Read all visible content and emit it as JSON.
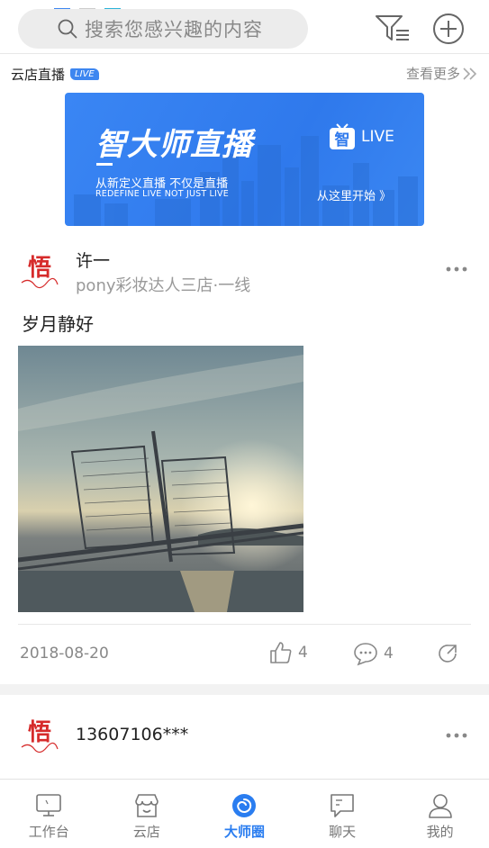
{
  "search": {
    "placeholder": "搜索您感兴趣的内容"
  },
  "live_section": {
    "title": "云店直播",
    "badge": "LIVE",
    "see_more": "查看更多"
  },
  "banner": {
    "title": "智大师直播",
    "live_label": "LIVE",
    "tv_glyph": "智",
    "subtitle_cn": "从新定义直播  不仅是直播",
    "subtitle_en": "REDEFINE LIVE  NOT JUST LIVE",
    "start_label": "从这里开始 》"
  },
  "posts": [
    {
      "name": "许一",
      "shop": "pony彩妆达人三店·一线",
      "text": "岁月静好",
      "date": "2018-08-20",
      "likes": "4",
      "comments": "4"
    },
    {
      "name": "13607106***"
    }
  ],
  "tabs": [
    {
      "label": "工作台",
      "icon": "monitor-icon",
      "active": false
    },
    {
      "label": "云店",
      "icon": "shop-icon",
      "active": false
    },
    {
      "label": "大师圈",
      "icon": "circle-icon",
      "active": true
    },
    {
      "label": "聊天",
      "icon": "chat-icon",
      "active": false
    },
    {
      "label": "我的",
      "icon": "user-icon",
      "active": false
    }
  ],
  "colors": {
    "accent": "#2a7df0",
    "banner": "#3a86f4",
    "avatar_red": "#d62b2b"
  }
}
